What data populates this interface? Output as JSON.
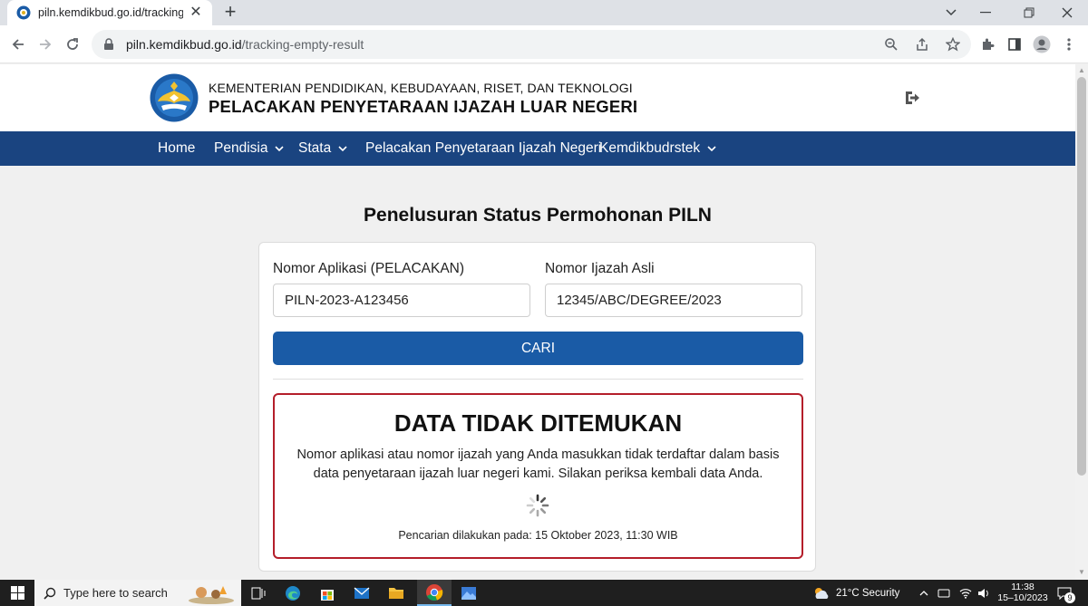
{
  "browser": {
    "tab_title": "piln.kemdikbud.go.id/tracking-e",
    "url_host": "piln.kemdikbud.go.id",
    "url_path": "/tracking-empty-result"
  },
  "site": {
    "org_name": "KEMENTERIAN PENDIDIKAN, KEBUDAYAAN, RISET, DAN TEKNOLOGI",
    "title": "PELACAKAN PENYETARAAN IJAZAH LUAR NEGERI",
    "brand_color": "#1a4480"
  },
  "nav": {
    "home": "Home",
    "pendisia": "Pendisia",
    "stata": "Stata",
    "pelacakan": "Pelacakan Penyetaraan Ijazah Negeri",
    "kemdikbud": "Kemdikbudrstek"
  },
  "main": {
    "heading": "Penelusuran Status Permohonan PILN",
    "app_number_label": "Nomor Aplikasi (PELACAKAN)",
    "app_number_value": "PILN-2023-A123456",
    "diploma_label": "Nomor Ijazah Asli",
    "diploma_value": "12345/ABC/DEGREE/2023",
    "search_button": "CARI",
    "button_color": "#1a5ba6"
  },
  "result": {
    "title": "DATA TIDAK DITEMUKAN",
    "message": "Nomor aplikasi atau nomor ijazah yang Anda masukkan tidak terdaftar dalam basis data penyetaraan ijazah luar negeri kami. Silakan periksa kembali data Anda.",
    "searched_at": "Pencarian dilakukan pada: 15 Oktober 2023, 11:30 WIB",
    "border_color": "#b41e2a"
  },
  "taskbar": {
    "search_placeholder": "Type here to search",
    "weather": "21°C  Security",
    "time": "11:38",
    "date": "15–10/2023",
    "notification_count": "9"
  }
}
